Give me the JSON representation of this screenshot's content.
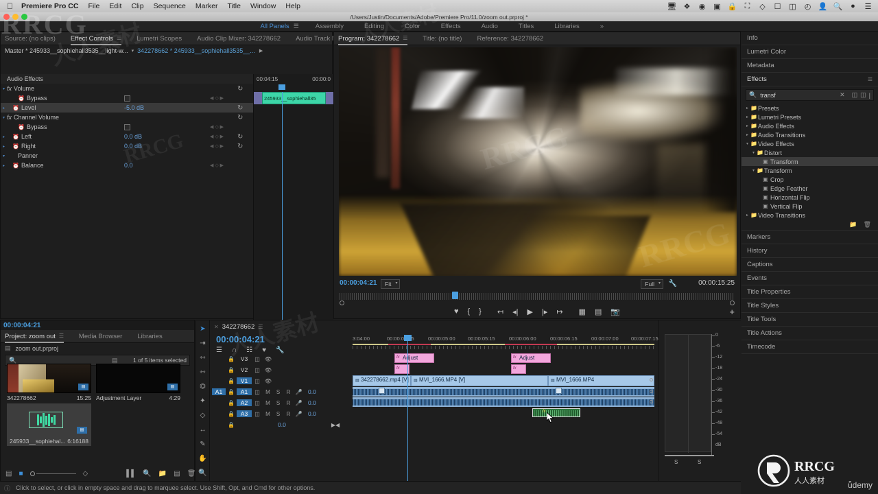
{
  "macbar": {
    "apple": "apple-logo",
    "app": "Premiere Pro CC",
    "menus": [
      "File",
      "Edit",
      "Clip",
      "Sequence",
      "Marker",
      "Title",
      "Window",
      "Help"
    ],
    "right_icons": [
      "display-icon",
      "dropbox-icon",
      "chrome-icon",
      "screen-icon",
      "lock-icon",
      "camera-icon",
      "shield-icon",
      "airplay-icon",
      "battery-icon",
      "clock-icon",
      "user-icon",
      "search-icon",
      "siri-icon",
      "list-icon"
    ]
  },
  "titlebar": {
    "path": "/Users/Justin/Documents/Adobe/Premiere Pro/11.0/zoom out.prproj *"
  },
  "workspace": {
    "active": "All Panels",
    "items": [
      "Assembly",
      "Editing",
      "Color",
      "Effects",
      "Audio",
      "Titles",
      "Libraries"
    ],
    "overflow": "»"
  },
  "effect_controls": {
    "tabs": [
      {
        "label": "Source: (no clips)",
        "active": false
      },
      {
        "label": "Effect Controls",
        "active": true
      },
      {
        "label": "Lumetri Scopes",
        "active": false
      },
      {
        "label": "Audio Clip Mixer: 342278662",
        "active": false
      },
      {
        "label": "Audio Track Mixer",
        "active": false
      }
    ],
    "overflow": "»",
    "master": "Master * 245933__sophiehall3535__light-w...",
    "sequence": "342278662 * 245933__sophiehall3535__...",
    "section_title": "Audio Effects",
    "timeline_left": "00:04:15",
    "timeline_right": "00:00:0",
    "clip_label": "245933__sophiehall35",
    "rows": [
      {
        "type": "section",
        "label": "Audio Effects"
      },
      {
        "type": "fx",
        "label": "Volume",
        "reset": true
      },
      {
        "type": "prop",
        "label": "Bypass",
        "value": "",
        "checkbox": true,
        "nav": true
      },
      {
        "type": "prop",
        "label": "Level",
        "value": "-5.0 dB",
        "highlight": true,
        "reset": true
      },
      {
        "type": "fx",
        "label": "Channel Volume",
        "reset": true
      },
      {
        "type": "prop",
        "label": "Bypass",
        "value": "",
        "checkbox": true,
        "nav": true
      },
      {
        "type": "prop",
        "label": "Left",
        "value": "0.0 dB",
        "nav": true,
        "reset": true
      },
      {
        "type": "prop",
        "label": "Right",
        "value": "0.0 dB",
        "nav": true,
        "reset": true
      },
      {
        "type": "group",
        "label": "Panner"
      },
      {
        "type": "prop",
        "label": "Balance",
        "value": "0.0",
        "nav": true
      }
    ]
  },
  "program": {
    "tabs": [
      {
        "label": "Program: 342278662",
        "active": true
      },
      {
        "label": "Title: (no title)",
        "active": false
      },
      {
        "label": "Reference: 342278662",
        "active": false
      }
    ],
    "current_time": "00:00:04:21",
    "zoom_level": "Fit",
    "quality": "Full",
    "duration": "00:00:15:25",
    "buttons": [
      "marker-icon",
      "mark-in-icon",
      "mark-out-icon",
      "go-to-in-icon",
      "step-back-icon",
      "play-icon",
      "step-forward-icon",
      "go-to-out-icon",
      "lift-icon",
      "extract-icon",
      "export-frame-icon"
    ],
    "add_button": "+"
  },
  "right_sidebar": {
    "top_tabs": [
      "Info",
      "Lumetri Color",
      "Metadata"
    ],
    "effects_tab": "Effects",
    "search": {
      "value": "transf",
      "clear": "✕"
    },
    "tree": [
      {
        "label": "Presets",
        "depth": 0,
        "type": "folder",
        "expanded": false
      },
      {
        "label": "Lumetri Presets",
        "depth": 0,
        "type": "folder",
        "expanded": false
      },
      {
        "label": "Audio Effects",
        "depth": 0,
        "type": "folder",
        "expanded": false
      },
      {
        "label": "Audio Transitions",
        "depth": 0,
        "type": "folder",
        "expanded": false
      },
      {
        "label": "Video Effects",
        "depth": 0,
        "type": "folder",
        "expanded": true
      },
      {
        "label": "Distort",
        "depth": 1,
        "type": "folder",
        "expanded": true
      },
      {
        "label": "Transform",
        "depth": 2,
        "type": "effect",
        "selected": true
      },
      {
        "label": "Transform",
        "depth": 1,
        "type": "folder",
        "expanded": true
      },
      {
        "label": "Crop",
        "depth": 2,
        "type": "effect"
      },
      {
        "label": "Edge Feather",
        "depth": 2,
        "type": "effect"
      },
      {
        "label": "Horizontal Flip",
        "depth": 2,
        "type": "effect"
      },
      {
        "label": "Vertical Flip",
        "depth": 2,
        "type": "effect"
      },
      {
        "label": "Video Transitions",
        "depth": 0,
        "type": "folder",
        "expanded": false
      }
    ],
    "tree_footer": [
      "new-bin-icon",
      "delete-icon"
    ],
    "bottom_tabs": [
      "Markers",
      "History",
      "Captions",
      "Events",
      "Title Properties",
      "Title Styles",
      "Title Tools",
      "Title Actions",
      "Timecode"
    ]
  },
  "project": {
    "timecode": "00:00:04:21",
    "tabs": [
      {
        "label": "Project: zoom out",
        "active": true
      },
      {
        "label": "Media Browser",
        "active": false
      },
      {
        "label": "Libraries",
        "active": false
      }
    ],
    "file": "zoom out.prproj",
    "search_placeholder": "",
    "selection_status": "1 of 5 items selected",
    "items": [
      {
        "name": "342278662",
        "duration": "15:25",
        "kind": "video"
      },
      {
        "name": "Adjustment Layer",
        "duration": "4:29",
        "kind": "black"
      },
      {
        "name": "245933__sophiehal...",
        "duration": "6:16188",
        "kind": "audio",
        "selected": true
      }
    ],
    "footer_icons": [
      "list-view-icon",
      "icon-view-icon",
      "zoom-slider",
      "sort-icon",
      "auto-sequence-icon",
      "find-icon",
      "new-bin-icon",
      "new-item-icon",
      "trash-icon"
    ]
  },
  "toolbar": {
    "tools": [
      {
        "name": "selection-tool",
        "glyph": "▶",
        "active": true
      },
      {
        "name": "track-select-forward-tool",
        "glyph": "⇥"
      },
      {
        "name": "ripple-edit-tool",
        "glyph": "⬌"
      },
      {
        "name": "rolling-edit-tool",
        "glyph": "⬌"
      },
      {
        "name": "rate-stretch-tool",
        "glyph": "✚"
      },
      {
        "name": "razor-tool",
        "glyph": "✂"
      },
      {
        "name": "slip-tool",
        "glyph": "↔"
      },
      {
        "name": "slide-tool",
        "glyph": "▣"
      },
      {
        "name": "pen-tool",
        "glyph": "✎"
      },
      {
        "name": "hand-tool",
        "glyph": "✋"
      },
      {
        "name": "zoom-tool",
        "glyph": "⚲"
      }
    ]
  },
  "timeline": {
    "tab": "342278662",
    "current_time": "00:00:04:21",
    "header_icons": [
      "nest-icon",
      "snap-icon",
      "linked-selection-icon",
      "marker-icon",
      "settings-icon"
    ],
    "ruler_ticks": [
      "3:04:00",
      "00:00:04:15",
      "00:00:05:00",
      "00:00:05:15",
      "00:00:06:00",
      "00:00:06:15",
      "00:00:07:00",
      "00:00:07:15"
    ],
    "tracks": [
      {
        "name": "V3",
        "type": "video",
        "targeted": false
      },
      {
        "name": "V2",
        "type": "video",
        "targeted": false
      },
      {
        "name": "V1",
        "type": "video",
        "targeted": true
      },
      {
        "name": "A1",
        "type": "audio",
        "targeted": true,
        "level": "0.0",
        "src": "A1"
      },
      {
        "name": "A2",
        "type": "audio",
        "targeted": true,
        "level": "0.0"
      },
      {
        "name": "A3",
        "type": "audio",
        "targeted": true,
        "level": "0.0"
      },
      {
        "name": "",
        "type": "master",
        "level": "0.0"
      }
    ],
    "clips": [
      {
        "label": "Adjust",
        "track": "V3",
        "color": "pink"
      },
      {
        "label": "Adjust",
        "track": "V3",
        "color": "pink"
      },
      {
        "label": "342278662.mp4 [V]",
        "track": "V1",
        "color": "blue"
      },
      {
        "label": "MVI_1666.MP4 [V]",
        "track": "V1",
        "color": "blue"
      },
      {
        "label": "MVI_1666.MP4",
        "track": "V1",
        "color": "blue"
      }
    ]
  },
  "audio_meters": {
    "labels": [
      "0",
      "-6",
      "-12",
      "-18",
      "-24",
      "-30",
      "-36",
      "-42",
      "-48",
      "-54",
      "dB"
    ],
    "channels": [
      "S",
      "S"
    ]
  },
  "status_bar": {
    "message": "Click to select, or click in empty space and drag to marquee select. Use Shift, Opt, and Cmd for other options.",
    "icon": "tool-tip-icon"
  },
  "branding": {
    "watermark_primary": "RRCG",
    "watermark_secondary": "人人素材",
    "logo_text": "RRCG",
    "logo_sub": "人人素材",
    "udemy": "ǖdemy"
  },
  "colors": {
    "accent_blue": "#4b9fe0",
    "clip_blue": "#9ec4e8",
    "clip_pink": "#f0a8d8",
    "clip_green": "#2f7a3f",
    "selection": "#2f6fa8",
    "panel_bg": "#1e1e1e"
  }
}
